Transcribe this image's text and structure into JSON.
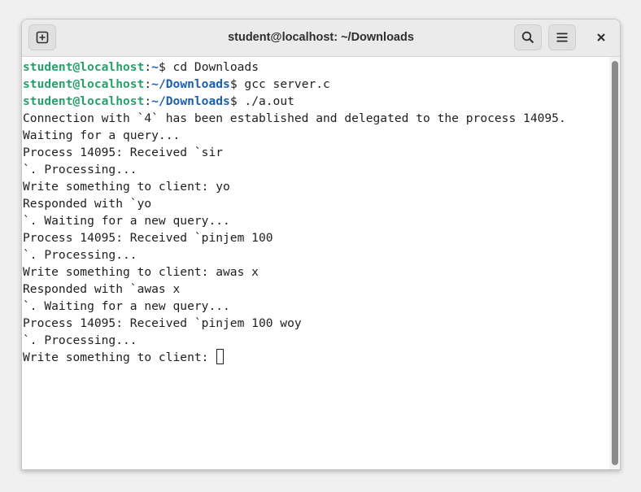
{
  "window": {
    "title": "student@localhost: ~/Downloads"
  },
  "header": {
    "icons": [
      "new-tab-icon",
      "search-icon",
      "hamburger-menu-icon",
      "close-icon"
    ]
  },
  "terminal": {
    "prompt_user": "student@localhost",
    "commands": [
      {
        "path": "~",
        "command": "cd Downloads"
      },
      {
        "path": "~/Downloads",
        "command": "gcc server.c"
      },
      {
        "path": "~/Downloads",
        "command": "./a.out"
      }
    ],
    "output": [
      "Connection with `4` has been established and delegated to the process 14095.",
      "Waiting for a query...",
      "Process 14095: Received `sir",
      "`. Processing...",
      "Write something to client: yo",
      "Responded with `yo",
      "`. Waiting for a new query...",
      "Process 14095: Received `pinjem 100",
      "`. Processing...",
      "Write something to client: awas x",
      "Responded with `awas x",
      "`. Waiting for a new query...",
      "Process 14095: Received `pinjem 100 woy",
      "`. Processing..."
    ],
    "current_input_prompt": "Write something to client: "
  },
  "colors": {
    "user": "#26a269",
    "path": "#1a5fb4",
    "text": "#1e1e1e"
  }
}
